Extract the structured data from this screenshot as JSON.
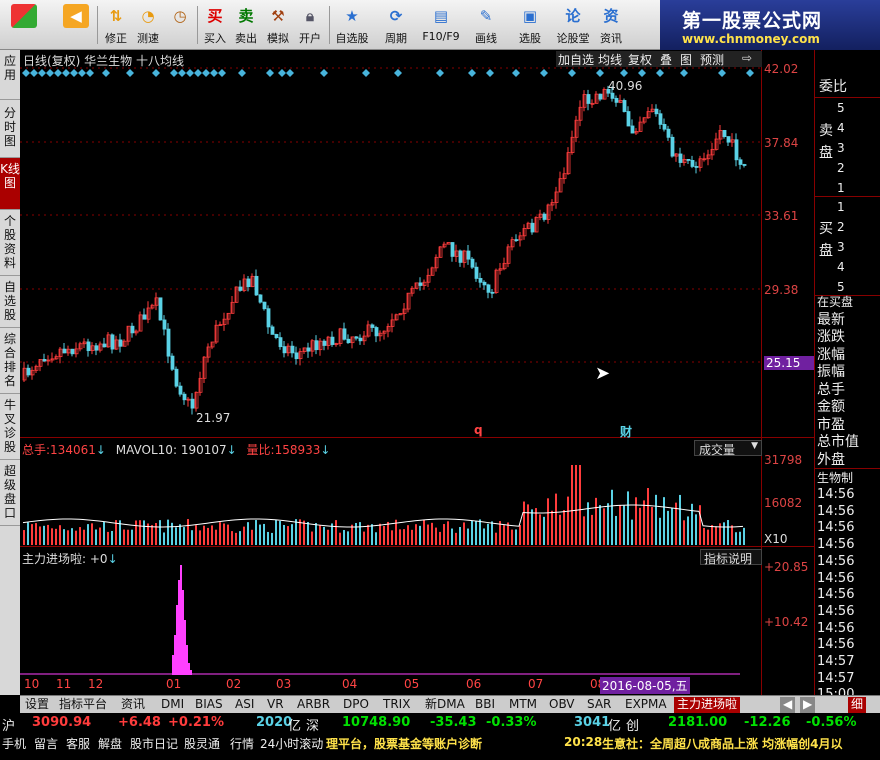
{
  "toolbar": {
    "buttons": [
      {
        "label": "",
        "icon": "grid-icon"
      },
      {
        "label": "",
        "icon": "back-arrow-icon"
      },
      {
        "label": "修正",
        "icon": "updown-icon"
      },
      {
        "label": "测速",
        "icon": "clock-icon"
      },
      {
        "label": "买入",
        "icon": "buy-icon"
      },
      {
        "label": "卖出",
        "icon": "sell-icon"
      },
      {
        "label": "模拟",
        "icon": "hammer-icon"
      },
      {
        "label": "开户",
        "icon": "lock-icon"
      },
      {
        "label": "自选股",
        "icon": "star-icon"
      },
      {
        "label": "周期",
        "icon": "cycle-icon"
      },
      {
        "label": "F10/F9",
        "icon": "f10-icon"
      },
      {
        "label": "画线",
        "icon": "pen-icon"
      },
      {
        "label": "选股",
        "icon": "screen-icon"
      },
      {
        "label": "论股堂",
        "icon": "forum-icon"
      },
      {
        "label": "资讯",
        "icon": "news-icon"
      }
    ],
    "glyphs": {
      "buy": "买",
      "sell": "卖",
      "forum": "论",
      "news": "资"
    },
    "brand_title": "第一股票公式网",
    "brand_url": "www.chnmoney.com"
  },
  "left_tabs": [
    "应用",
    "分时图",
    "K线图",
    "个股资料",
    "自选股",
    "综合排名",
    "牛叉诊股",
    "超级盘口"
  ],
  "chart_header": {
    "title": "日线(复权) 华兰生物 十八均线",
    "buttons": [
      "加自选",
      "均线",
      "复权",
      "叠",
      "图",
      "预测"
    ]
  },
  "price_axis": [
    "42.02",
    "37.84",
    "33.61",
    "29.38",
    "25.15"
  ],
  "price_annotations": {
    "high": "40.96",
    "low": "21.97",
    "q_marker": "q",
    "cai_marker": "财"
  },
  "volume_panel": {
    "total_label": "总手:",
    "total_value": "134061",
    "mavol_label": "MAVOL10:",
    "mavol_value": "190107",
    "ratio_label": "量比:",
    "ratio_value": "158933",
    "selector": "成交量",
    "axis": [
      "31798",
      "16082",
      "X10"
    ]
  },
  "indicator_panel": {
    "label": "主力进场啦:",
    "value": "+0",
    "help": "指标说明",
    "axis": [
      "+20.85",
      "+10.42"
    ]
  },
  "x_axis": {
    "labels": [
      "10",
      "11",
      "12",
      "01",
      "02",
      "03",
      "04",
      "05",
      "06",
      "07",
      "08"
    ],
    "cursor_date": "2016-08-05,五"
  },
  "right_panel": {
    "title": "委比",
    "sell_label": "卖盘",
    "sell_nums": [
      "5",
      "4",
      "3",
      "2",
      "1"
    ],
    "buy_label": "买盘",
    "buy_nums": [
      "1",
      "2",
      "3",
      "4",
      "5"
    ],
    "items": [
      "在买盘",
      "最新",
      "涨跌",
      "涨幅",
      "振幅",
      "总手",
      "金额",
      "市盈",
      "总市值",
      "外盘",
      "生物制"
    ],
    "times": [
      "14:56",
      "14:56",
      "14:56",
      "14:56",
      "14:56",
      "14:56",
      "14:56",
      "14:56",
      "14:56",
      "14:56",
      "14:57",
      "14:57",
      "15:00"
    ]
  },
  "bottom_tabs": [
    "设置",
    "指标平台",
    "资讯",
    "DMI",
    "BIAS",
    "ASI",
    "VR",
    "ARBR",
    "DPO",
    "TRIX",
    "新DMA",
    "BBI",
    "MTM",
    "OBV",
    "SAR",
    "EXPMA",
    "主力进场啦",
    "细"
  ],
  "status": {
    "sh_label": "沪",
    "sh_index": "3090.94",
    "sh_change": "+6.48",
    "sh_pct": "+0.21%",
    "sh_amount": "2020",
    "sh_unit": "亿",
    "sz_label": "深",
    "sz_index": "10748.90",
    "sz_change": "-35.43",
    "sz_pct": "-0.33%",
    "sz_amount": "3041",
    "sz_unit": "亿",
    "cy_label": "创",
    "cy_index": "2181.00",
    "cy_change": "-12.26",
    "cy_pct": "-0.56%"
  },
  "footer": {
    "items": [
      "手机",
      "留言",
      "客服",
      "解盘",
      "股市日记",
      "股灵通",
      "行情",
      "24小时滚动"
    ],
    "ticker_left": "理平台，股票基金等账户诊断",
    "ticker_time": "20:28",
    "ticker_right": "生意社：全周超八成商品上涨 均涨幅创4月以"
  },
  "colors": {
    "up": "#ff3c3c",
    "down": "#5ad2e6",
    "ma": "#ffffff",
    "indicator": "#ff40ff",
    "axisline": "#880000"
  }
}
